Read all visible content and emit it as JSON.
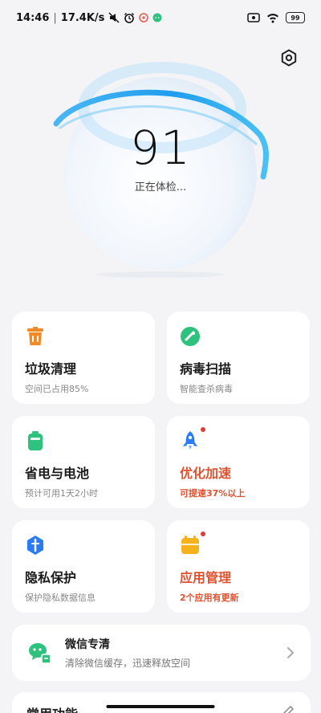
{
  "status_bar": {
    "time": "14:46",
    "speed": "17.4K/s",
    "battery": "99"
  },
  "hero": {
    "score": "91",
    "status": "正在体检..."
  },
  "cards": [
    {
      "title": "垃圾清理",
      "subtitle": "空间已占用85%",
      "icon": "trash-icon"
    },
    {
      "title": "病毒扫描",
      "subtitle": "智能查杀病毒",
      "icon": "shield-scan-icon"
    },
    {
      "title": "省电与电池",
      "subtitle": "预计可用1天2小时",
      "icon": "battery-icon"
    },
    {
      "title": "优化加速",
      "subtitle": "可提速37%以上",
      "icon": "rocket-icon",
      "highlight": true
    },
    {
      "title": "隐私保护",
      "subtitle": "保护隐私数据信息",
      "icon": "privacy-icon"
    },
    {
      "title": "应用管理",
      "subtitle": "2个应用有更新",
      "icon": "app-manage-icon",
      "highlight": true
    }
  ],
  "wechat": {
    "title": "微信专清",
    "subtitle": "清除微信缓存，迅速释放空间"
  },
  "common": {
    "title": "常用功能"
  },
  "colors": {
    "accent_orange": "#f08a24",
    "accent_green": "#2ec27e",
    "accent_blue": "#2a7bf6",
    "hot_red": "#e0512f",
    "orb_blue": "#2fa8f0"
  }
}
